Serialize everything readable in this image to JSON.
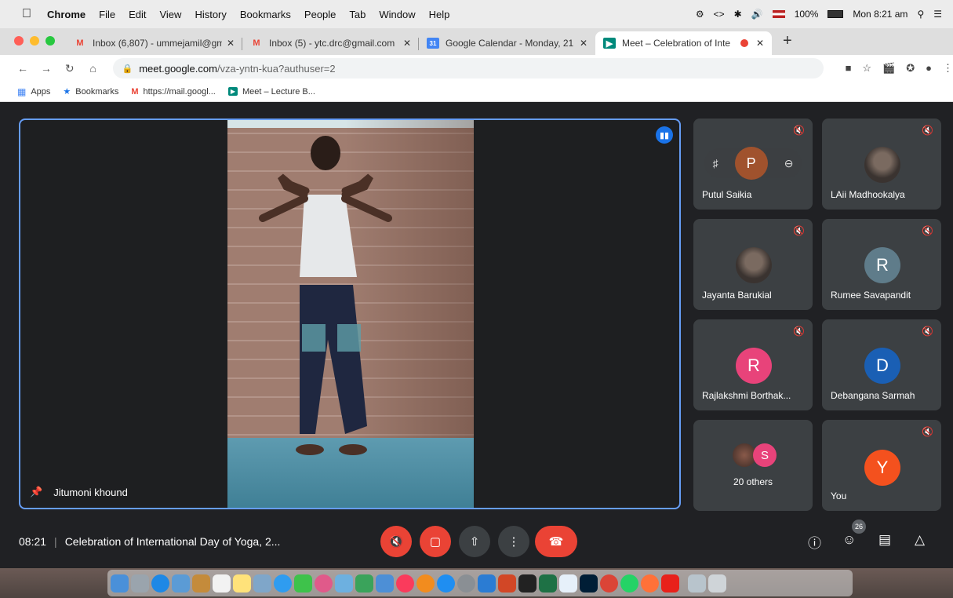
{
  "menubar": {
    "app": "Chrome",
    "items": [
      "File",
      "Edit",
      "View",
      "History",
      "Bookmarks",
      "People",
      "Tab",
      "Window",
      "Help"
    ],
    "battery": "100%",
    "clock": "Mon 8:21 am"
  },
  "tabs": [
    {
      "title": "Inbox (6,807) - ummejamil@gm",
      "icon": "gmail-icon",
      "color": "#ea4335"
    },
    {
      "title": "Inbox (5) - ytc.drc@gmail.com",
      "icon": "gmail-icon",
      "color": "#ea4335"
    },
    {
      "title": "Google Calendar - Monday, 21",
      "icon": "calendar-icon",
      "color": "#4285f4"
    },
    {
      "title": "Meet – Celebration of Inte",
      "icon": "meet-icon",
      "color": "#00897b",
      "active": true
    }
  ],
  "omnibox": {
    "host": "meet.google.com",
    "path": "/vza-yntn-kua?authuser=2"
  },
  "bookmarks": [
    {
      "label": "Apps",
      "icon": "apps-grid-icon"
    },
    {
      "label": "Bookmarks",
      "icon": "star-icon"
    },
    {
      "label": "https://mail.googl...",
      "icon": "gmail-icon"
    },
    {
      "label": "Meet – Lecture B...",
      "icon": "meet-icon"
    }
  ],
  "main_speaker": {
    "name": "Jitumoni khound"
  },
  "participants": [
    {
      "name": "Putul Saikia",
      "initial": "P",
      "color": "#a0522d",
      "hover": true
    },
    {
      "name": "LAii Madhookalya",
      "initial": "",
      "photo": true
    },
    {
      "name": "Jayanta Barukial",
      "initial": "",
      "photo": true
    },
    {
      "name": "Rumee Savapandit",
      "initial": "R",
      "color": "#5f7c8a"
    },
    {
      "name": "Rajlakshmi Borthak...",
      "initial": "R",
      "color": "#e8437a"
    },
    {
      "name": "Debangana Sarmah",
      "initial": "D",
      "color": "#1a5fb4"
    }
  ],
  "others": {
    "initial": "S",
    "label": "20 others"
  },
  "self_tile": {
    "name": "You",
    "initial": "Y",
    "color": "#f4511e"
  },
  "meeting": {
    "time": "08:21",
    "title": "Celebration of International Day of Yoga, 2..."
  },
  "people_count": "26"
}
